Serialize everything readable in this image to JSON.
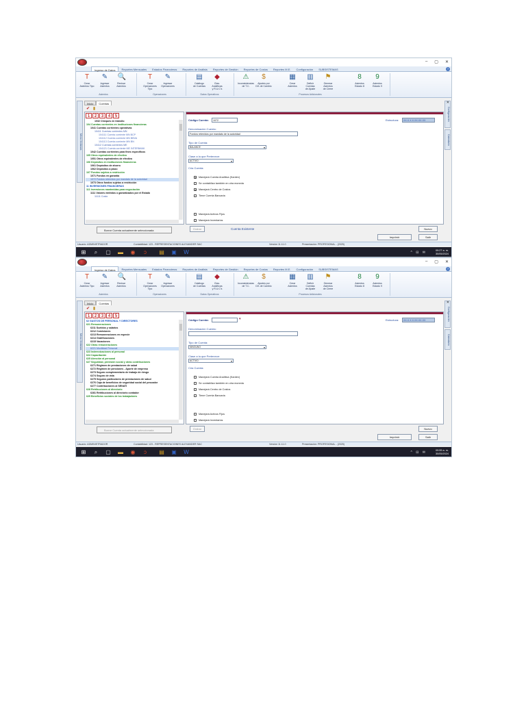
{
  "app": {
    "window_controls": [
      "–",
      "▢",
      "✕"
    ],
    "menu": [
      "Ingreso de Datos",
      "Reportes Mensuales",
      "Estados Financieros",
      "Reportes de Análisis",
      "Reportes de Gestión",
      "Reportes de Costos",
      "Reportes M.E.",
      "Configuración",
      "SUBSISTEMAS"
    ],
    "ribbon": {
      "buttons": [
        {
          "l1": "Crear",
          "l2": "Asientos Tipo",
          "icon": "T"
        },
        {
          "l1": "Ingresar",
          "l2": "Asientos",
          "icon": "✎"
        },
        {
          "l1": "Revisar",
          "l2": "Asientos",
          "icon": "🔍"
        },
        {
          "l1": "Crear",
          "l2": "Operaciones Tipo",
          "icon": "T"
        },
        {
          "l1": "Ingresar",
          "l2": "Operaciones",
          "icon": "✎"
        },
        {
          "l1": "Catálogo",
          "l2": "de Cuentas",
          "icon": "▤"
        },
        {
          "l1": "Ctas. Analíticas",
          "l2": "y R.U.C's",
          "icon": "◆"
        },
        {
          "l1": "Inconsistencias",
          "l2": "de T.C.",
          "icon": "⚠"
        },
        {
          "l1": "Ajustes por",
          "l2": "Dif. de Cambio",
          "icon": "$"
        },
        {
          "l1": "Crear",
          "l2": "Asientos",
          "icon": "▦"
        },
        {
          "l1": "Definir Cuentas",
          "l2": "de Ajuste",
          "icon": "▥"
        },
        {
          "l1": "Generar Asientos",
          "l2": "de Cierre",
          "icon": "⚑"
        },
        {
          "l1": "Asientos",
          "l2": "Estado 8",
          "icon": "8"
        },
        {
          "l1": "Asientos",
          "l2": "Estado 9",
          "icon": "9"
        }
      ],
      "groups": [
        "Asientos",
        "Operaciones",
        "Datos Operativos",
        "Procesos Adicionales"
      ]
    },
    "doc_tabs": [
      "Inicio",
      "Cuentas"
    ],
    "side_left": "Menú Ventanas",
    "side_right": [
      "Configuración",
      "Calendario"
    ],
    "num_tabs": [
      "1",
      "2",
      "3",
      "4",
      "5"
    ],
    "labels": {
      "codigo": "Código Cuenta:",
      "estructura": "Estructura:",
      "denominacion": "Denominación Cuenta:",
      "tipo": "Tipo de Cuenta:",
      "clase": "Clase a la que Pertenece:",
      "cria": "Cria Cuenta:"
    },
    "checks": [
      "Manejará Cuenta Analítica (Kardex)",
      "Se contabiliza también en otra moneda",
      "Manejará Centro de Costos",
      "Tiene Cuenta Bancaria",
      "Manejará Activos Fijos",
      "Manejará Inventarios"
    ],
    "buttons": {
      "borrar": "Borrar Cuenta actualmente seleccionada",
      "grabar": "Grabar",
      "nuevo": "Nuevo",
      "imprimir": "Imprimir",
      "salir": "Salir"
    },
    "status": {
      "usuario": "Usuario: ADMINISTRADOR",
      "contabilidad": "Contabilidad: 123 - REPRESENTACIONES ALEXANDER SAC",
      "version": "Versión 11.11.0",
      "presentacion": "Presentación: PROFESIONAL - (2025)"
    }
  },
  "shot1": {
    "codigo": "1072",
    "estructura": "XX.X.X.X.XX.XX.XX",
    "denominacion": "Fondos retenidos por mandato de la autoridad",
    "tipo": "BALANCE",
    "clase": "ACTIVO",
    "checked": [
      true,
      false,
      true,
      false,
      false,
      false
    ],
    "cuenta_existente": "Cuenta Existente",
    "time": "09:27 a. m.",
    "date": "30/05/2024",
    "tree": [
      {
        "t": "1032 Cheques en tránsito",
        "c": "lv3",
        "i": 2
      },
      {
        "t": "104 Cuentas corrientes en instituciones financieras",
        "c": "lv2",
        "i": 0
      },
      {
        "t": "1041 Cuentas corrientes operativas",
        "c": "lv3",
        "i": 1
      },
      {
        "t": "10411 Cuentas corrientes MN",
        "c": "lv4",
        "i": 2
      },
      {
        "t": "104111 Cuenta corriente MN BCP",
        "c": "lv5",
        "i": 3
      },
      {
        "t": "104112 Cuenta corriente MN BBVA",
        "c": "lv5",
        "i": 3
      },
      {
        "t": "104113 Cuenta corriente MN BN",
        "c": "lv5",
        "i": 3
      },
      {
        "t": "10412 Cuentas corrientes ME",
        "c": "lv4",
        "i": 2
      },
      {
        "t": "104121 Cuenta corriente ME INTERBANK",
        "c": "lv5",
        "i": 3
      },
      {
        "t": "1042 Cuentas corrientes para fines específicos",
        "c": "lv3",
        "i": 1
      },
      {
        "t": "105 Otros equivalentes de efectivo",
        "c": "lv2",
        "i": 0
      },
      {
        "t": "1051 Otros equivalentes de efectivo",
        "c": "lv3",
        "i": 1
      },
      {
        "t": "106 Depósitos en instituciones financieras",
        "c": "lv2",
        "i": 0
      },
      {
        "t": "1061 Depósitos de ahorro",
        "c": "lv3",
        "i": 1
      },
      {
        "t": "1062 Depósitos a plazo",
        "c": "lv3",
        "i": 1
      },
      {
        "t": "107 Fondos sujetos a restricción",
        "c": "lv2",
        "i": 0
      },
      {
        "t": "1071 Fondos en garantía",
        "c": "lv3",
        "i": 1
      },
      {
        "t": "1072 Fondos retenidos por mandato de la autoridad",
        "c": "lv4 sel",
        "i": 1
      },
      {
        "t": "1073 Otros fondos sujetos a restricción",
        "c": "lv3",
        "i": 1
      },
      {
        "t": "11 INVERSIONES FINANCIERAS",
        "c": "lv1",
        "i": 0
      },
      {
        "t": "111 Inversiones mantenidas para negociación",
        "c": "lv2",
        "i": 0
      },
      {
        "t": "1111 Valores emitidos o garantizados por el Estado",
        "c": "lv3",
        "i": 1
      },
      {
        "t": "11111 Costo",
        "c": "lv4",
        "i": 2
      }
    ]
  },
  "shot2": {
    "codigo": "",
    "estructura": "XX.X.X.X.XX.XX.XX",
    "denominacion": "",
    "tipo": "NINGUNO",
    "clase": "ACTIVO",
    "checked": [
      false,
      false,
      false,
      false,
      false,
      false
    ],
    "time": "09:55 a. m.",
    "date": "30/05/2024",
    "tree": [
      {
        "t": "62 GASTOS DE PERSONAL Y DIRECTORES",
        "c": "lv1",
        "i": 0
      },
      {
        "t": "621 Remuneraciones",
        "c": "lv2",
        "i": 0
      },
      {
        "t": "6211 Sueldos y salarios",
        "c": "lv3",
        "i": 1
      },
      {
        "t": "6212 Comisiones",
        "c": "lv3",
        "i": 1
      },
      {
        "t": "6213 Remuneraciones en especie",
        "c": "lv3",
        "i": 1
      },
      {
        "t": "6214 Gratificaciones",
        "c": "lv3",
        "i": 1
      },
      {
        "t": "6215 Vacaciones",
        "c": "lv3",
        "i": 1
      },
      {
        "t": "622 Otras remuneraciones",
        "c": "lv2",
        "i": 0
      },
      {
        "t": "6221 Movilidad Personal",
        "c": "lv4 sel",
        "i": 1
      },
      {
        "t": "623 Indemnizaciones al personal",
        "c": "lv2",
        "i": 0
      },
      {
        "t": "624 Capacitación",
        "c": "lv2",
        "i": 0
      },
      {
        "t": "625 Atención al personal",
        "c": "lv2",
        "i": 0
      },
      {
        "t": "627 Seguridad, previsión social y otras contribuciones",
        "c": "lv2",
        "i": 0
      },
      {
        "t": "6271 Régimen de prestaciones de salud",
        "c": "lv3",
        "i": 1
      },
      {
        "t": "6272 Régimen de pensiones - Aporte de empresa",
        "c": "lv3",
        "i": 1
      },
      {
        "t": "6273 Seguro complementario de trabajo de riesgo",
        "c": "lv3",
        "i": 1
      },
      {
        "t": "6274 Seguro de vida",
        "c": "lv3",
        "i": 1
      },
      {
        "t": "6275 Seguros particulares de prestaciones de salud",
        "c": "lv3",
        "i": 1
      },
      {
        "t": "6276 Caja de beneficios de seguridad social del pescador",
        "c": "lv3",
        "i": 1
      },
      {
        "t": "6277 Contribuciones al SENATI",
        "c": "lv3",
        "i": 1
      },
      {
        "t": "628 Retribuciones al directorio",
        "c": "lv2",
        "i": 0
      },
      {
        "t": "6281 Retribuciones al directorio contador",
        "c": "lv3",
        "i": 1
      },
      {
        "t": "629 Beneficios sociales de los trabajadores",
        "c": "lv2",
        "i": 0
      }
    ]
  }
}
